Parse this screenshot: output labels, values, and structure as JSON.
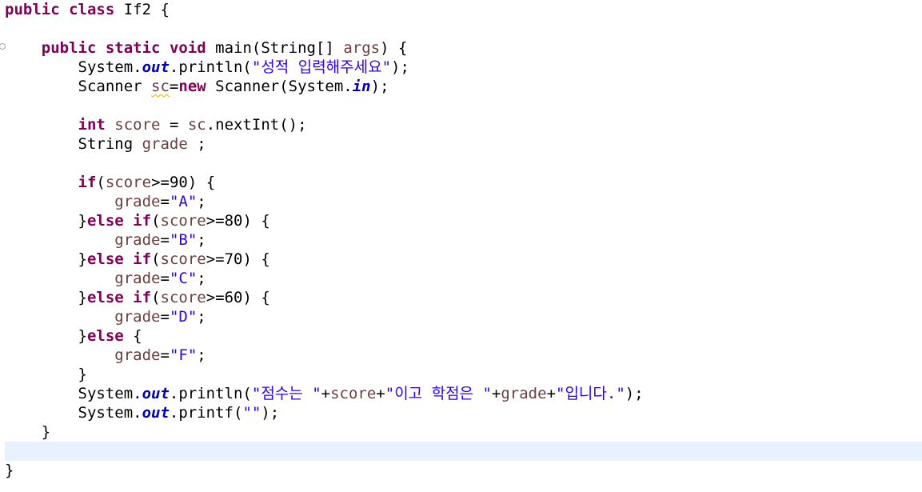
{
  "editor": {
    "colors": {
      "keyword": "#7f0055",
      "string": "#2a00ff",
      "static_field": "#0000c0",
      "local_variable": "#6a3e3e",
      "current_line_highlight": "#e8f2fe",
      "warning_underline": "#e0b000"
    },
    "lines": [
      [
        {
          "t": "public",
          "k": "kw"
        },
        {
          "t": " ",
          "k": "plain"
        },
        {
          "t": "class",
          "k": "kw"
        },
        {
          "t": " If2 {",
          "k": "plain"
        }
      ],
      [],
      [
        {
          "t": "    ",
          "k": "plain"
        },
        {
          "t": "public",
          "k": "kw"
        },
        {
          "t": " ",
          "k": "plain"
        },
        {
          "t": "static",
          "k": "kw"
        },
        {
          "t": " ",
          "k": "plain"
        },
        {
          "t": "void",
          "k": "kw"
        },
        {
          "t": " main(String[] ",
          "k": "plain"
        },
        {
          "t": "args",
          "k": "var"
        },
        {
          "t": ") {",
          "k": "plain"
        }
      ],
      [
        {
          "t": "        System.",
          "k": "plain"
        },
        {
          "t": "out",
          "k": "static-field"
        },
        {
          "t": ".println(",
          "k": "plain"
        },
        {
          "t": "\"성적 입력해주세요\"",
          "k": "str"
        },
        {
          "t": ");",
          "k": "plain"
        }
      ],
      [
        {
          "t": "        Scanner ",
          "k": "plain"
        },
        {
          "t": "sc",
          "k": "var warn"
        },
        {
          "t": "=",
          "k": "plain"
        },
        {
          "t": "new",
          "k": "kw"
        },
        {
          "t": " Scanner(System.",
          "k": "plain"
        },
        {
          "t": "in",
          "k": "static-field"
        },
        {
          "t": ");",
          "k": "plain"
        }
      ],
      [],
      [
        {
          "t": "        ",
          "k": "plain"
        },
        {
          "t": "int",
          "k": "kw"
        },
        {
          "t": " ",
          "k": "plain"
        },
        {
          "t": "score",
          "k": "var"
        },
        {
          "t": " = ",
          "k": "plain"
        },
        {
          "t": "sc",
          "k": "var"
        },
        {
          "t": ".nextInt();",
          "k": "plain"
        }
      ],
      [
        {
          "t": "        String ",
          "k": "plain"
        },
        {
          "t": "grade",
          "k": "var"
        },
        {
          "t": " ;",
          "k": "plain"
        }
      ],
      [],
      [
        {
          "t": "        ",
          "k": "plain"
        },
        {
          "t": "if",
          "k": "kw"
        },
        {
          "t": "(",
          "k": "plain"
        },
        {
          "t": "score",
          "k": "var"
        },
        {
          "t": ">=90) {",
          "k": "plain"
        }
      ],
      [
        {
          "t": "            ",
          "k": "plain"
        },
        {
          "t": "grade",
          "k": "var"
        },
        {
          "t": "=",
          "k": "plain"
        },
        {
          "t": "\"A\"",
          "k": "str"
        },
        {
          "t": ";",
          "k": "plain"
        }
      ],
      [
        {
          "t": "        }",
          "k": "plain"
        },
        {
          "t": "else",
          "k": "kw"
        },
        {
          "t": " ",
          "k": "plain"
        },
        {
          "t": "if",
          "k": "kw"
        },
        {
          "t": "(",
          "k": "plain"
        },
        {
          "t": "score",
          "k": "var"
        },
        {
          "t": ">=80) {",
          "k": "plain"
        }
      ],
      [
        {
          "t": "            ",
          "k": "plain"
        },
        {
          "t": "grade",
          "k": "var"
        },
        {
          "t": "=",
          "k": "plain"
        },
        {
          "t": "\"B\"",
          "k": "str"
        },
        {
          "t": ";",
          "k": "plain"
        }
      ],
      [
        {
          "t": "        }",
          "k": "plain"
        },
        {
          "t": "else",
          "k": "kw"
        },
        {
          "t": " ",
          "k": "plain"
        },
        {
          "t": "if",
          "k": "kw"
        },
        {
          "t": "(",
          "k": "plain"
        },
        {
          "t": "score",
          "k": "var"
        },
        {
          "t": ">=70) {",
          "k": "plain"
        }
      ],
      [
        {
          "t": "            ",
          "k": "plain"
        },
        {
          "t": "grade",
          "k": "var"
        },
        {
          "t": "=",
          "k": "plain"
        },
        {
          "t": "\"C\"",
          "k": "str"
        },
        {
          "t": ";",
          "k": "plain"
        }
      ],
      [
        {
          "t": "        }",
          "k": "plain"
        },
        {
          "t": "else",
          "k": "kw"
        },
        {
          "t": " ",
          "k": "plain"
        },
        {
          "t": "if",
          "k": "kw"
        },
        {
          "t": "(",
          "k": "plain"
        },
        {
          "t": "score",
          "k": "var"
        },
        {
          "t": ">=60) {",
          "k": "plain"
        }
      ],
      [
        {
          "t": "            ",
          "k": "plain"
        },
        {
          "t": "grade",
          "k": "var"
        },
        {
          "t": "=",
          "k": "plain"
        },
        {
          "t": "\"D\"",
          "k": "str"
        },
        {
          "t": ";",
          "k": "plain"
        }
      ],
      [
        {
          "t": "        }",
          "k": "plain"
        },
        {
          "t": "else",
          "k": "kw"
        },
        {
          "t": " {",
          "k": "plain"
        }
      ],
      [
        {
          "t": "            ",
          "k": "plain"
        },
        {
          "t": "grade",
          "k": "var"
        },
        {
          "t": "=",
          "k": "plain"
        },
        {
          "t": "\"F\"",
          "k": "str"
        },
        {
          "t": ";",
          "k": "plain"
        }
      ],
      [
        {
          "t": "        }",
          "k": "plain"
        }
      ],
      [
        {
          "t": "        System.",
          "k": "plain"
        },
        {
          "t": "out",
          "k": "static-field"
        },
        {
          "t": ".println(",
          "k": "plain"
        },
        {
          "t": "\"점수는 \"",
          "k": "str"
        },
        {
          "t": "+",
          "k": "plain"
        },
        {
          "t": "score",
          "k": "var"
        },
        {
          "t": "+",
          "k": "plain"
        },
        {
          "t": "\"이고 학점은 \"",
          "k": "str"
        },
        {
          "t": "+",
          "k": "plain"
        },
        {
          "t": "grade",
          "k": "var"
        },
        {
          "t": "+",
          "k": "plain"
        },
        {
          "t": "\"입니다.\"",
          "k": "str"
        },
        {
          "t": ");",
          "k": "plain"
        }
      ],
      [
        {
          "t": "        System.",
          "k": "plain"
        },
        {
          "t": "out",
          "k": "static-field"
        },
        {
          "t": ".printf(",
          "k": "plain"
        },
        {
          "t": "\"\"",
          "k": "str"
        },
        {
          "t": ");",
          "k": "plain"
        }
      ],
      [
        {
          "t": "    }",
          "k": "plain"
        }
      ],
      [],
      [
        {
          "t": "}",
          "k": "plain"
        }
      ]
    ]
  }
}
